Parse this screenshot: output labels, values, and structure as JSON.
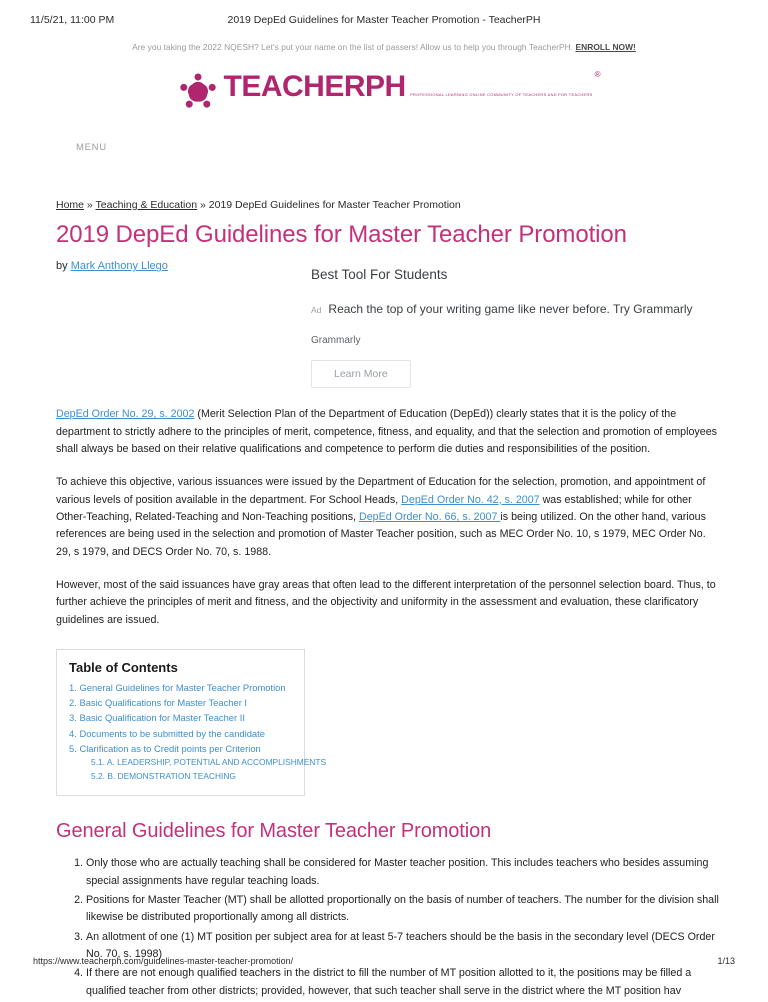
{
  "print": {
    "date": "11/5/21, 11:00 PM",
    "doc_title": "2019 DepEd Guidelines for Master Teacher Promotion - TeacherPH",
    "footer_url": "https://www.teacherph.com/guidelines-master-teacher-promotion/",
    "page_number": "1/13"
  },
  "announcement": {
    "text": "Are you taking the 2022 NQESH? Let's put your name on the list of passers! Allow us to help you through TeacherPH. ",
    "cta": "ENROLL NOW!"
  },
  "logo": {
    "wordmark": "TEACHERPH",
    "registered": "®",
    "tagline": "PROFESSIONAL LEARNING ONLINE COMMUNITY OF TEACHERS AND FOR TEACHERS",
    "color": "#b0266e"
  },
  "nav": {
    "menu_label": "MENU"
  },
  "breadcrumb": {
    "home": "Home",
    "sep1": " » ",
    "category": "Teaching & Education",
    "sep2": " » ",
    "current": "2019 DepEd Guidelines for Master Teacher Promotion"
  },
  "article": {
    "title": "2019 DepEd Guidelines for Master Teacher Promotion",
    "title_color": "#c4317a",
    "by_label": "by ",
    "author": "Mark Anthony Llego",
    "link_color": "#3d8fd1"
  },
  "ad": {
    "headline": "Best Tool For Students",
    "badge": "Ad",
    "description": "Reach the top of your writing game like never before. Try Grammarly",
    "brand": "Grammarly",
    "cta": "Learn More"
  },
  "paragraphs": {
    "p1_link": "DepEd Order No. 29, s. 2002",
    "p1_rest": " (Merit Selection Plan of the Department of Education (DepEd)) clearly states that it is the policy of the department to strictly adhere to the principles of merit, competence, fitness, and equality, and that the selection and promotion of employees shall always be based on their relative qualifications and competence to perform die duties and responsibilities of the position.",
    "p2_a": "To achieve this objective, various issuances were issued by the Department of Education for the selection, promotion, and appointment of various levels of position available in the department. For School Heads, ",
    "p2_link1": "DepEd Order No. 42, s. 2007",
    "p2_b": " was established; while for other Other-Teaching, Related-Teaching and Non-Teaching positions, ",
    "p2_link2": "DepEd Order No. 66, s. 2007 ",
    "p2_c": "is being utilized. On the other hand, various references are being used in the selection and promotion of Master Teacher position, such as MEC Order No. 10, s 1979, MEC Order No. 29, s 1979, and DECS Order No. 70, s. 1988.",
    "p3": "However, most of the said issuances have gray areas that often lead to the different interpretation of the personnel selection board. Thus, to further achieve the principles of merit and fitness, and the objectivity and uniformity in the assessment and evaluation, these clarificatory guidelines are issued."
  },
  "toc": {
    "title": "Table of Contents",
    "items": [
      {
        "num": "1.",
        "label": "General Guidelines for Master Teacher Promotion"
      },
      {
        "num": "2.",
        "label": "Basic Qualifications for Master Teacher I"
      },
      {
        "num": "3.",
        "label": "Basic Qualification for Master Teacher II"
      },
      {
        "num": "4.",
        "label": "Documents to be submitted by the candidate"
      },
      {
        "num": "5.",
        "label": "Clarification as to Credit points per Criterion"
      }
    ],
    "subitems": [
      {
        "num": "5.1.",
        "label": "A. LEADERSHIP, POTENTIAL AND ACCOMPLISHMENTS"
      },
      {
        "num": "5.2.",
        "label": "B. DEMONSTRATION TEACHING"
      }
    ]
  },
  "section": {
    "heading": "General Guidelines for Master Teacher Promotion",
    "items": [
      "Only those who are actually teaching shall be considered for Master teacher position. This includes teachers who besides assuming special assignments have regular teaching loads.",
      "Positions for Master Teacher (MT) shall be allotted proportionally on the basis of number of teachers. The number for the division shall likewise be distributed proportionally among all districts.",
      "An allotment of one (1) MT position per subject area for at least 5-7 teachers should be the basis in the secondary level (DECS Order No. 70, s. 1998)",
      "If there are not enough qualified teachers in the district to fill the number of MT position allotted to it, the positions may be filled a qualified teacher from other districts; provided, however, that such teacher shall serve in the district where the MT position hav"
    ]
  }
}
